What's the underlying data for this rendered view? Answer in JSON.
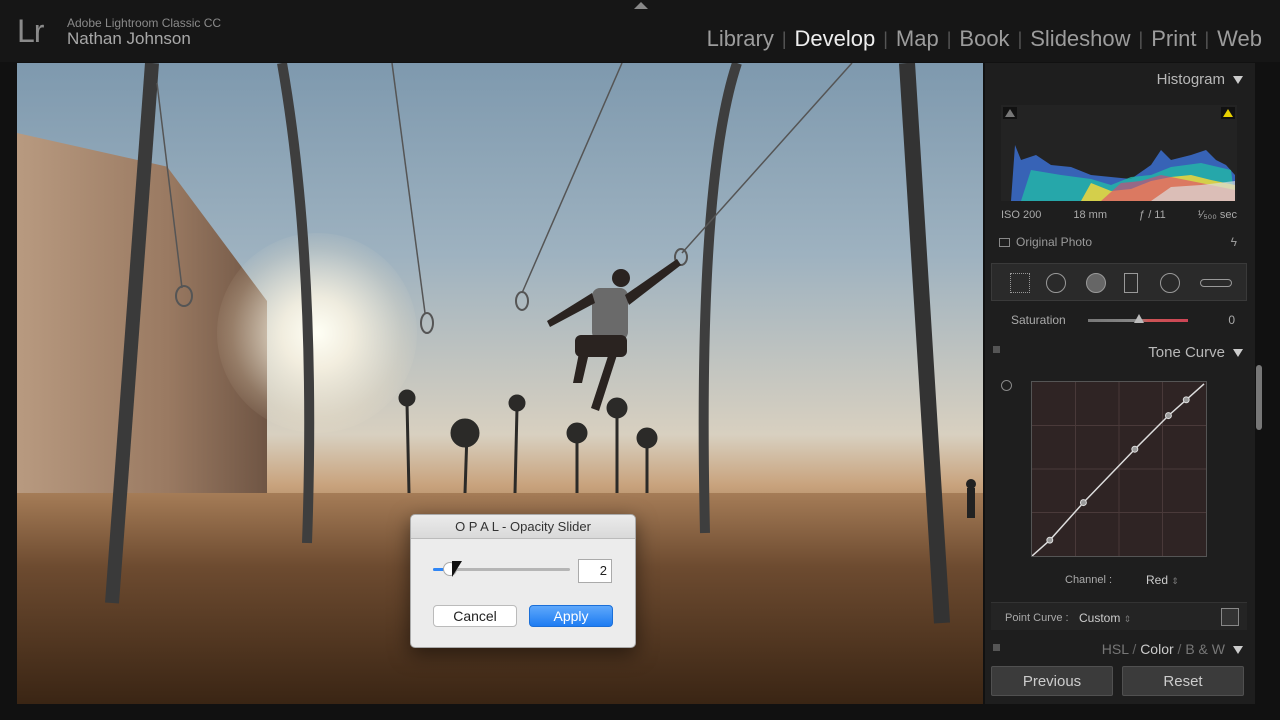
{
  "app": {
    "logo": "Lr",
    "title": "Adobe Lightroom Classic CC",
    "user": "Nathan Johnson"
  },
  "modules": [
    "Library",
    "Develop",
    "Map",
    "Book",
    "Slideshow",
    "Print",
    "Web"
  ],
  "active_module": "Develop",
  "histogram": {
    "title": "Histogram",
    "iso": "ISO 200",
    "focal": "18 mm",
    "aperture": "ƒ / 11",
    "shutter": "¹⁄₅₀₀ sec",
    "original_photo": "Original Photo"
  },
  "saturation": {
    "label": "Saturation",
    "value": "0"
  },
  "tone_curve": {
    "title": "Tone Curve",
    "channel_label": "Channel :",
    "channel_value": "Red",
    "point_curve_label": "Point Curve :",
    "point_curve_value": "Custom"
  },
  "hsl": {
    "hsl": "HSL",
    "color": "Color",
    "bw": "B & W"
  },
  "buttons": {
    "previous": "Previous",
    "reset": "Reset"
  },
  "dialog": {
    "title": "O P A L - Opacity Slider",
    "value": "2",
    "slider_fraction": 0.02,
    "cancel": "Cancel",
    "apply": "Apply"
  },
  "colors": {
    "accent": "#2f86f6",
    "panel": "#1e1e1e"
  }
}
